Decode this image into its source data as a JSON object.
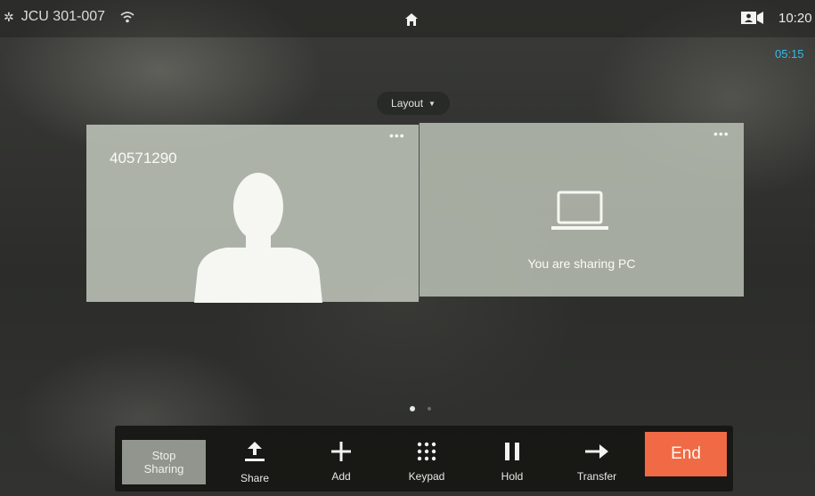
{
  "status_bar": {
    "room_name": "JCU 301-007",
    "clock": "10:20",
    "call_duration": "05:15"
  },
  "layout_button": {
    "label": "Layout"
  },
  "participants": [
    {
      "caller_id": "40571290"
    },
    {
      "share_text": "You are sharing PC"
    }
  ],
  "toolbar": {
    "stop_sharing": "Stop\nSharing",
    "share": "Share",
    "add": "Add",
    "keypad": "Keypad",
    "hold": "Hold",
    "transfer": "Transfer",
    "end": "End"
  },
  "colors": {
    "end": "#f06a45",
    "duration": "#38b8e6"
  },
  "icons": [
    "gear-icon",
    "wifi-icon",
    "home-icon",
    "camera-icon",
    "more-dots-icon",
    "person-silhouette-icon",
    "laptop-icon",
    "share-upload-icon",
    "plus-icon",
    "keypad-icon",
    "pause-icon",
    "arrow-right-icon"
  ],
  "pager": {
    "pages": 2,
    "active": 1
  }
}
